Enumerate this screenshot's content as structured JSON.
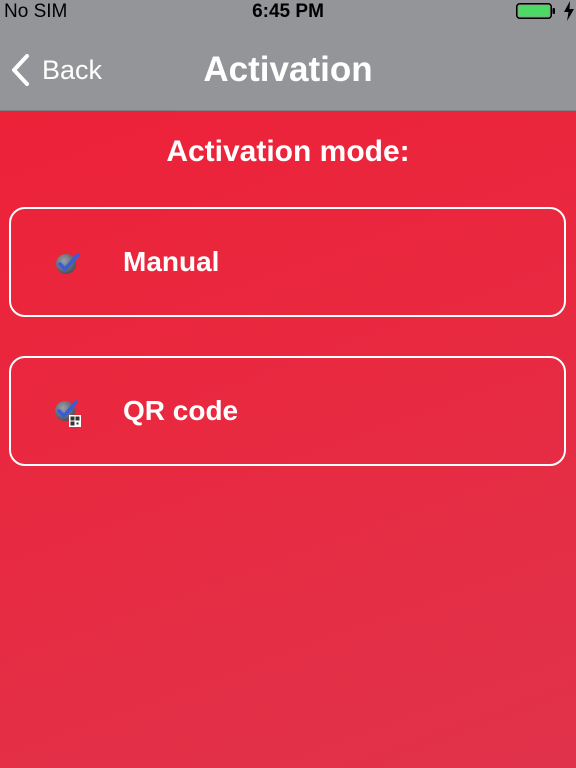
{
  "status_bar": {
    "carrier": "No SIM",
    "time": "6:45 PM",
    "battery_level": 1.0,
    "battery_color": "#4cd964"
  },
  "nav": {
    "back_label": "Back",
    "title": "Activation"
  },
  "main": {
    "heading": "Activation mode:",
    "options": [
      {
        "label": "Manual",
        "icon": "checkmark-icon"
      },
      {
        "label": "QR code",
        "icon": "qr-checkmark-icon"
      }
    ]
  },
  "colors": {
    "background": "#ec2439",
    "bar": "#939598",
    "text": "#ffffff"
  }
}
